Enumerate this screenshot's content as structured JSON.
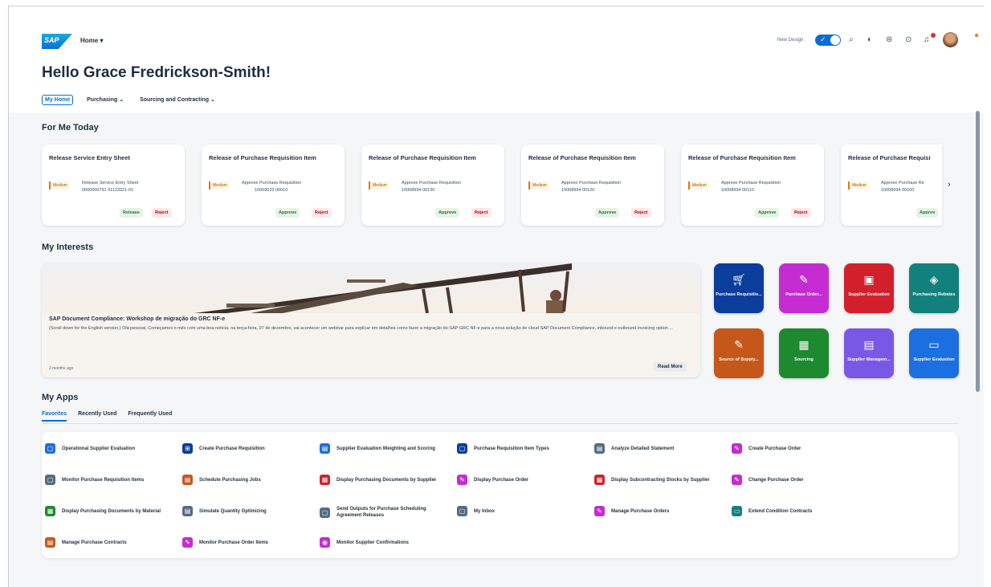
{
  "shell": {
    "logo": "SAP",
    "home_menu": "Home ▾",
    "new_design_label": "New Design",
    "icons": [
      "search-icon",
      "copilot-icon",
      "notification-center-icon",
      "help-icon",
      "bell-icon",
      "avatar"
    ]
  },
  "page": {
    "greeting": "Hello Grace Fredrickson-Smith!",
    "tabs": [
      {
        "label": "My Home"
      },
      {
        "label": "Purchasing  ⌄"
      },
      {
        "label": "Sourcing and Contracting  ⌄"
      }
    ]
  },
  "for_me_today": {
    "title": "For Me Today",
    "cards": [
      {
        "title": "Release Service Entry Sheet",
        "priority": "Medium",
        "desc1": "Release Service Entry Sheet",
        "desc2": "0000000791 01122021-01",
        "approve": "Release",
        "reject": "Reject"
      },
      {
        "title": "Release of Purchase Requisition Item",
        "priority": "Medium",
        "desc1": "Approve Purchase Requisition",
        "desc2": "10009023 00010",
        "approve": "Approve",
        "reject": "Reject"
      },
      {
        "title": "Release of Purchase Requisition Item",
        "priority": "Medium",
        "desc1": "Approve Purchase Requisition",
        "desc2": "10008994 00130",
        "approve": "Approve",
        "reject": "Reject"
      },
      {
        "title": "Release of Purchase Requisition Item",
        "priority": "Medium",
        "desc1": "Approve Purchase Requisition",
        "desc2": "10008994 00120",
        "approve": "Approve",
        "reject": "Reject"
      },
      {
        "title": "Release of Purchase Requisition Item",
        "priority": "Medium",
        "desc1": "Approve Purchase Requisition",
        "desc2": "10008994 00110",
        "approve": "Approve",
        "reject": "Reject"
      },
      {
        "title": "Release of Purchase Requisi",
        "priority": "Medium",
        "desc1": "Approve Purchase Re",
        "desc2": "10008994 00160",
        "approve": "Approv",
        "reject": ""
      }
    ]
  },
  "my_interests": {
    "title": "My Interests",
    "news": {
      "title": "SAP Document Compliance: Workshop de migração do GRC NF-e",
      "text": "(Scroll down for the English version.) Olá pessoal, Começamos o mês com uma boa notícia: na terça-feira, 07 de dezembro, vai acontecer um webinar para explicar em detalhes como fazer a migração do SAP GRC NF-e para a nova solução de cloud SAP Document Compliance, inbound e outbound invoicing option ...",
      "time": "2 months ago",
      "read_more": "Read More"
    },
    "tiles": [
      {
        "label": "Purchase Requisitio...",
        "icon": "🛒",
        "color": "#0a3d9c"
      },
      {
        "label": "Purchase Order...",
        "icon": "✎",
        "color": "#c42cd1"
      },
      {
        "label": "Supplier Evaluation",
        "icon": "▣",
        "color": "#d1202b"
      },
      {
        "label": "Purchasing Rebates",
        "icon": "◈",
        "color": "#12817d"
      },
      {
        "label": "Source of Supply...",
        "icon": "✎",
        "color": "#c6571b"
      },
      {
        "label": "Sourcing",
        "icon": "▦",
        "color": "#1d8a2f"
      },
      {
        "label": "Supplier Managem...",
        "icon": "▤",
        "color": "#7a58e6"
      },
      {
        "label": "Supplier Evaluation",
        "icon": "▭",
        "color": "#1b6fe0"
      }
    ]
  },
  "my_apps": {
    "title": "My Apps",
    "tabs": [
      {
        "label": "Favorites"
      },
      {
        "label": "Recently Used"
      },
      {
        "label": "Frequently Used"
      }
    ],
    "apps": [
      {
        "label": "Operational Supplier Evaluation",
        "color": "#1b6fe0",
        "icon": "▢"
      },
      {
        "label": "Create Purchase Requisition",
        "color": "#0a3d9c",
        "icon": "🛒"
      },
      {
        "label": "Supplier Evaluation Weighting and Scoring",
        "color": "#1b6fe0",
        "icon": "▤"
      },
      {
        "label": "Purchase Requisition Item Types",
        "color": "#0a3d9c",
        "icon": "▢"
      },
      {
        "label": "Analyze Detailed Statement",
        "color": "#556b82",
        "icon": "▤"
      },
      {
        "label": "Create Purchase Order",
        "color": "#c42cd1",
        "icon": "✎"
      },
      {
        "label": "Monitor Purchase Requisition Items",
        "color": "#556b82",
        "icon": "▢"
      },
      {
        "label": "Schedule Purchasing Jobs",
        "color": "#c6571b",
        "icon": "▤"
      },
      {
        "label": "Display Purchasing Documents by Supplier",
        "color": "#d1202b",
        "icon": "▦"
      },
      {
        "label": "Display Purchase Order",
        "color": "#c42cd1",
        "icon": "✎"
      },
      {
        "label": "Display Subcontracting Stocks by Supplier",
        "color": "#d1202b",
        "icon": "▦"
      },
      {
        "label": "Change Purchase Order",
        "color": "#c42cd1",
        "icon": "✎"
      },
      {
        "label": "Display Purchasing Documents by Material",
        "color": "#1d8a2f",
        "icon": "▦"
      },
      {
        "label": "Simulate Quantity Optimizing",
        "color": "#556b82",
        "icon": "▤"
      },
      {
        "label": "Send Outputs for Purchase Scheduling Agreement Releases",
        "color": "#556b82",
        "icon": "▢"
      },
      {
        "label": "My Inbox",
        "color": "#556b82",
        "icon": "▢"
      },
      {
        "label": "Manage Purchase Orders",
        "color": "#c42cd1",
        "icon": "✎"
      },
      {
        "label": "Extend Condition Contracts",
        "color": "#12817d",
        "icon": "▭"
      },
      {
        "label": "Manage Purchase Contracts",
        "color": "#c6571b",
        "icon": "▤"
      },
      {
        "label": "Monitor Purchase Order Items",
        "color": "#c42cd1",
        "icon": "✎"
      },
      {
        "label": "Monitor Supplier Confirmations",
        "color": "#c42cd1",
        "icon": "◉"
      }
    ]
  }
}
